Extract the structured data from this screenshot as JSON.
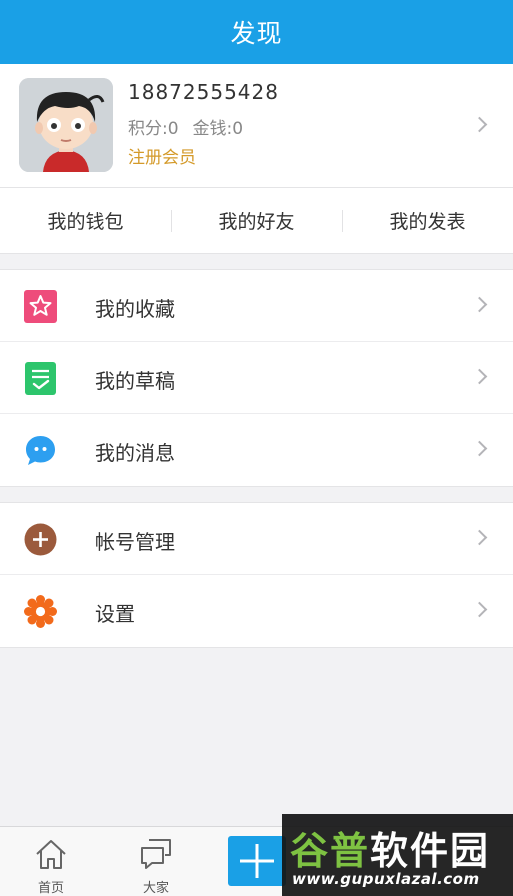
{
  "header": {
    "title": "发现"
  },
  "profile": {
    "phone": "18872555428",
    "points": "积分:0",
    "money": "金钱:0",
    "level": "注册会员"
  },
  "quick_links": [
    {
      "label": "我的钱包"
    },
    {
      "label": "我的好友"
    },
    {
      "label": "我的发表"
    }
  ],
  "menu_group_1": [
    {
      "label": "我的收藏",
      "icon": "star-icon",
      "color": "#ee4c7b"
    },
    {
      "label": "我的草稿",
      "icon": "draft-icon",
      "color": "#2dc56c"
    },
    {
      "label": "我的消息",
      "icon": "message-icon",
      "color": "#2d9ff0"
    }
  ],
  "menu_group_2": [
    {
      "label": "帐号管理",
      "icon": "account-plus-icon",
      "color": "#9b5a3c"
    },
    {
      "label": "设置",
      "icon": "gear-icon",
      "color": "#f26a1b"
    }
  ],
  "tabbar": {
    "home_label": "首页",
    "community_label": "大家"
  },
  "watermark": {
    "brand_green": "谷普",
    "brand_white": "软件园",
    "url": "www.gupuxlazal.com"
  },
  "colors": {
    "accent": "#1aa0e6",
    "level": "#d49a2a"
  }
}
